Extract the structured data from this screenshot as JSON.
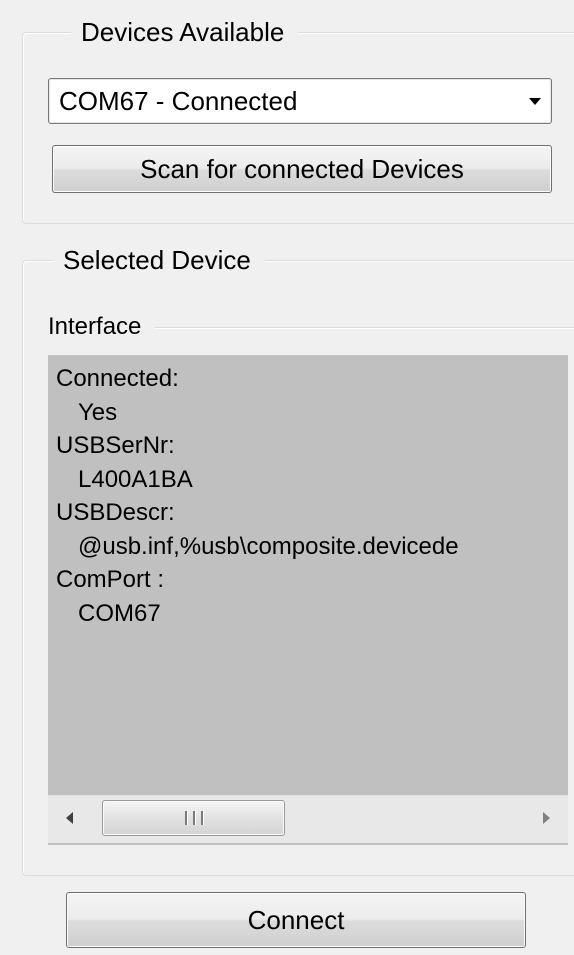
{
  "devices_available": {
    "title": "Devices Available",
    "selected_device": "COM67 - Connected",
    "scan_button_label": "Scan for connected Devices"
  },
  "selected_device": {
    "title": "Selected Device",
    "interface_label": "Interface",
    "info_lines": [
      {
        "kind": "label",
        "text": "Connected:"
      },
      {
        "kind": "value",
        "text": "Yes"
      },
      {
        "kind": "label",
        "text": "USBSerNr:"
      },
      {
        "kind": "value",
        "text": "L400A1BA"
      },
      {
        "kind": "label",
        "text": "USBDescr:"
      },
      {
        "kind": "value",
        "text": "@usb.inf,%usb\\composite.devicede"
      },
      {
        "kind": "label",
        "text": "ComPort :"
      },
      {
        "kind": "value",
        "text": "COM67"
      }
    ]
  },
  "connect_button_label": "Connect",
  "icons": {
    "combo_arrow": "chevron-down-icon",
    "scroll_left": "arrow-left-icon",
    "scroll_right": "arrow-right-icon",
    "scroll_grip": "grip-icon"
  },
  "colors": {
    "window_background": "#f0f0f0",
    "info_panel_background": "#c0c0c0",
    "groupbox_border": "#dcdcdc"
  }
}
